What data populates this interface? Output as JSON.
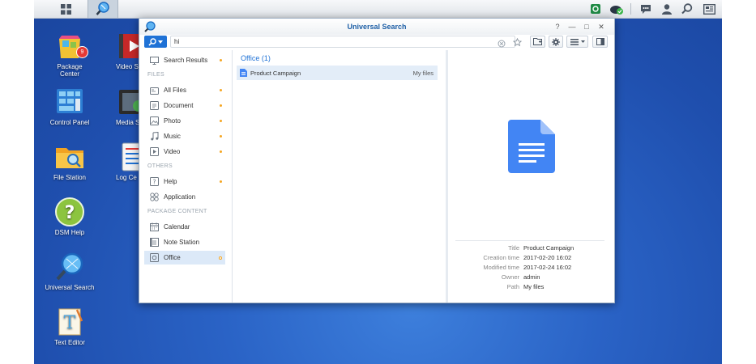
{
  "taskbar": {
    "main_menu_icon": "grid-icon",
    "app_icon": "universal-search-icon",
    "right_icons": [
      "notification-app-icon",
      "cloud-sync-icon",
      "chat-icon",
      "user-icon",
      "search-icon",
      "widgets-icon"
    ]
  },
  "desktop": {
    "icons": [
      {
        "label": "Package Center",
        "badge": "9"
      },
      {
        "label": "Control Panel"
      },
      {
        "label": "File Station"
      },
      {
        "label": "DSM Help"
      },
      {
        "label": "Universal Search"
      },
      {
        "label": "Text Editor"
      },
      {
        "label": "Video St"
      },
      {
        "label": "Media S"
      },
      {
        "label": "Log Ce"
      }
    ]
  },
  "window": {
    "title": "Universal Search",
    "controls": [
      "?",
      "—",
      "□",
      "✕"
    ]
  },
  "toolbar": {
    "search_value": "hi",
    "search_placeholder": ""
  },
  "sidebar": {
    "search_results": "Search Results",
    "section_files": "FILES",
    "section_others": "OTHERS",
    "section_package": "PACKAGE CONTENT",
    "items": [
      {
        "label": "All Files",
        "icon": "all-files-icon",
        "dot": true
      },
      {
        "label": "Document",
        "icon": "document-icon",
        "dot": true
      },
      {
        "label": "Photo",
        "icon": "photo-icon",
        "dot": true
      },
      {
        "label": "Music",
        "icon": "music-icon",
        "dot": true
      },
      {
        "label": "Video",
        "icon": "video-icon",
        "dot": true
      },
      {
        "label": "Help",
        "icon": "help-icon",
        "dot": true
      },
      {
        "label": "Application",
        "icon": "application-icon",
        "dot": false
      },
      {
        "label": "Calendar",
        "icon": "calendar-icon",
        "dot": false
      },
      {
        "label": "Note Station",
        "icon": "note-icon",
        "dot": false
      },
      {
        "label": "Office",
        "icon": "office-icon",
        "dot": true,
        "active": true
      }
    ]
  },
  "results": {
    "group_title": "Office (1)",
    "rows": [
      {
        "name": "Product Campaign",
        "location": "My files"
      }
    ]
  },
  "preview": {
    "meta": [
      {
        "key": "Title",
        "value": "Product Campaign"
      },
      {
        "key": "Creation time",
        "value": "2017-02-20 16:02"
      },
      {
        "key": "Modified time",
        "value": "2017-02-24 16:02"
      },
      {
        "key": "Owner",
        "value": "admin"
      },
      {
        "key": "Path",
        "value": "My files"
      }
    ]
  },
  "colors": {
    "accent": "#1f72d6",
    "desktop": "#2a63c6",
    "dot": "#f5a623"
  }
}
